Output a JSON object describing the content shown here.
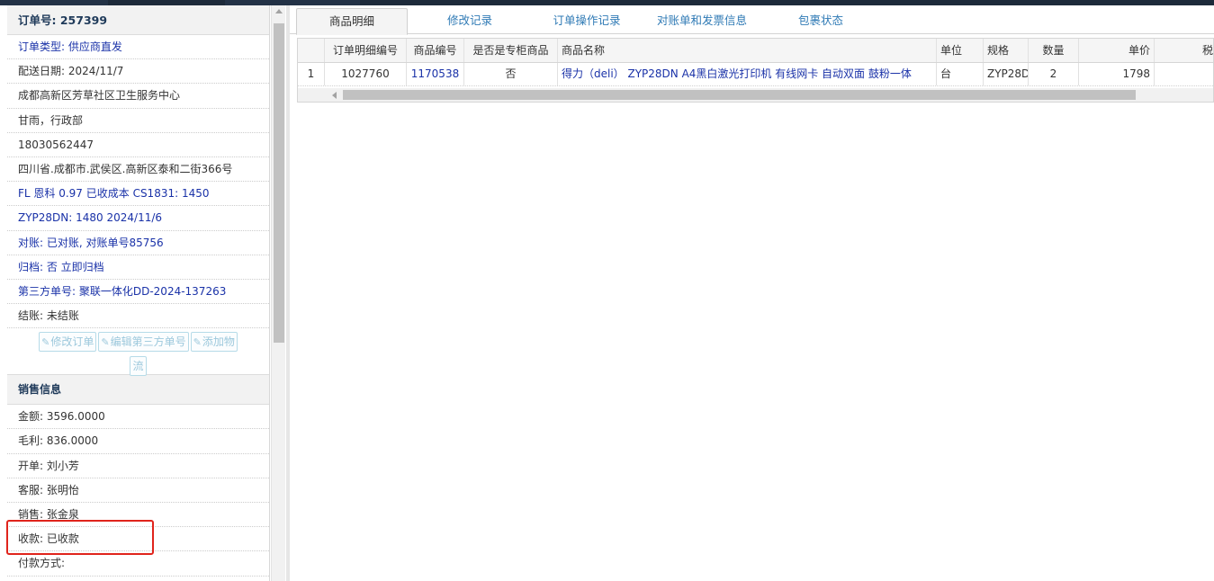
{
  "order": {
    "title": "订单号: 257399",
    "rows": [
      {
        "text": "订单类型: 供应商直发",
        "blue": true
      },
      {
        "text": "配送日期: 2024/11/7",
        "blue": false
      },
      {
        "text": "成都高新区芳草社区卫生服务中心",
        "blue": false
      },
      {
        "text": "甘雨，行政部",
        "blue": false
      },
      {
        "text": "18030562447",
        "blue": false
      },
      {
        "text": "四川省.成都市.武侯区.高新区泰和二街366号",
        "blue": false
      },
      {
        "text": "FL 恩科 0.97 已收成本 CS1831: 1450",
        "blue": true
      },
      {
        "text": "ZYP28DN: 1480 2024/11/6",
        "blue": true
      },
      {
        "text": "对账: 已对账, 对账单号85756",
        "blue": true
      },
      {
        "text": "归档: 否 立即归档",
        "blue": true
      },
      {
        "text": "第三方单号: 聚联一体化DD-2024-137263",
        "blue": true
      },
      {
        "text": "结账: 未结账",
        "blue": false
      }
    ],
    "buttons": {
      "edit_order": "修改订单",
      "edit_third_party": "编辑第三方单号",
      "add_logistics_1": "添加物",
      "add_logistics_2": "流"
    }
  },
  "sales": {
    "title": "销售信息",
    "rows": [
      "金额: 3596.0000",
      "毛利: 836.0000",
      "开单: 刘小芳",
      "客服: 张明怡",
      "销售: 张金泉",
      "收款: 已收款",
      "付款方式:"
    ]
  },
  "tabs": [
    "商品明细",
    "修改记录",
    "订单操作记录",
    "对账单和发票信息",
    "包裹状态"
  ],
  "table": {
    "headers": [
      "",
      "订单明细编号",
      "商品编号",
      "是否是专柜商品",
      "商品名称",
      "单位",
      "规格",
      "数量",
      "单价",
      "税"
    ],
    "rows": [
      [
        "1",
        "1027760",
        "1170538",
        "否",
        "得力（deli） ZYP28DN A4黑白激光打印机 有线网卡 自动双面 鼓粉一体",
        "台",
        "ZYP28D",
        "2",
        "1798",
        ""
      ]
    ]
  },
  "colors": {
    "accent_blue": "#1a32a8",
    "tab_blue": "#2f7ab5",
    "highlight_red": "#e0241c"
  }
}
